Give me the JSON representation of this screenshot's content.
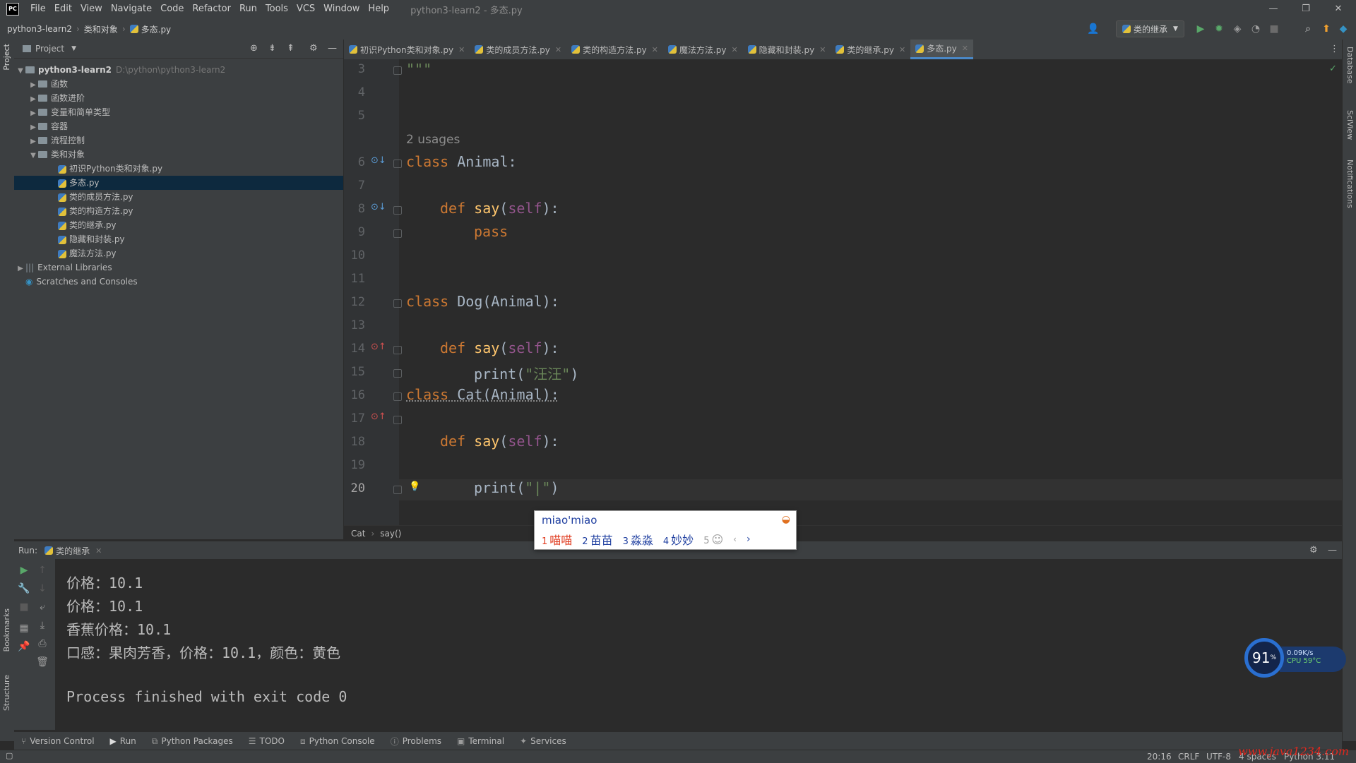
{
  "menubar": {
    "logo": "PC",
    "items": [
      "File",
      "Edit",
      "View",
      "Navigate",
      "Code",
      "Refactor",
      "Run",
      "Tools",
      "VCS",
      "Window",
      "Help"
    ],
    "title": "python3-learn2 - 多态.py",
    "min": "—",
    "restore": "❐",
    "close": "✕"
  },
  "navbar": {
    "crumbs": [
      "python3-learn2",
      "类和对象",
      "多态.py"
    ],
    "run_config": "类的继承"
  },
  "left_stripe": {
    "project": "Project",
    "bookmarks": "Bookmarks",
    "structure": "Structure"
  },
  "right_stripe": {
    "database": "Database",
    "sciview": "SciView",
    "notifications": "Notifications"
  },
  "project": {
    "header": "Project",
    "root": {
      "name": "python3-learn2",
      "path": "D:\\python\\python3-learn2"
    },
    "folders": [
      "函数",
      "函数进阶",
      "变量和简单类型",
      "容器",
      "流程控制",
      "类和对象"
    ],
    "files": [
      "初识Python类和对象.py",
      "多态.py",
      "类的成员方法.py",
      "类的构造方法.py",
      "类的继承.py",
      "隐藏和封装.py",
      "魔法方法.py"
    ],
    "external": "External Libraries",
    "scratches": "Scratches and Consoles"
  },
  "tabs": [
    "初识Python类和对象.py",
    "类的成员方法.py",
    "类的构造方法.py",
    "魔法方法.py",
    "隐藏和封装.py",
    "类的继承.py",
    "多态.py"
  ],
  "editor": {
    "line_numbers": [
      "3",
      "4",
      "5",
      "6",
      "7",
      "8",
      "9",
      "10",
      "11",
      "12",
      "13",
      "14",
      "15",
      "16",
      "17",
      "18",
      "19",
      "20"
    ],
    "usages": "2 usages",
    "code": {
      "l3": "\"\"\"",
      "class_kw": "class",
      "animal_decl": " Animal:",
      "def_kw": "def",
      "say": "say",
      "self": "self",
      "pass": "pass",
      "dog_decl": " Dog(Animal):",
      "cat_decl": " Cat(Animal):",
      "print": "print",
      "wang": "\"汪汪\"",
      "cursor_str": "\"|\"",
      "sig_open": "(",
      "sig_close": "):",
      "paren_open": "(",
      "paren_close": ")"
    }
  },
  "breadcrumb": {
    "cls": "Cat",
    "method": "say()"
  },
  "ime": {
    "composition": "miao'miao",
    "candidates": [
      {
        "idx": "1",
        "text": "喵喵"
      },
      {
        "idx": "2",
        "text": "苗苗"
      },
      {
        "idx": "3",
        "text": "淼淼"
      },
      {
        "idx": "4",
        "text": "妙妙"
      },
      {
        "idx": "5",
        "text": "☺"
      }
    ]
  },
  "run": {
    "label": "Run:",
    "config": "类的继承",
    "output": [
      "价格：10.1",
      "价格：10.1",
      "香蕉价格：10.1",
      "口感：果肉芳香，价格：10.1，颜色：黄色",
      "",
      "Process finished with exit code 0"
    ]
  },
  "bottom_tabs": [
    "Version Control",
    "Run",
    "Python Packages",
    "TODO",
    "Python Console",
    "Problems",
    "Terminal",
    "Services"
  ],
  "status": {
    "position": "20:16",
    "line_sep": "CRLF",
    "encoding": "UTF-8",
    "indent": "4 spaces",
    "interpreter": "Python 3.11",
    "watermark": "www.java1234.com"
  },
  "perf": {
    "percent": "91",
    "unit": "%",
    "net": "0.09K/s",
    "cpu": "CPU 59°C"
  },
  "colors": {
    "accent": "#4a88c7",
    "keyword": "#cc7832",
    "function": "#ffc66d",
    "self": "#94558d",
    "string": "#6a8759",
    "selection": "#0d293e"
  }
}
